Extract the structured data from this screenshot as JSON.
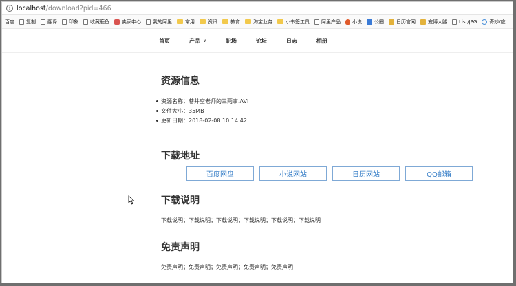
{
  "browser": {
    "url_host": "localhost",
    "url_path": "/download?pid=466",
    "bookmarks": [
      {
        "label": "百度",
        "icon": "none"
      },
      {
        "label": "复制",
        "icon": "page"
      },
      {
        "label": "翻译",
        "icon": "page"
      },
      {
        "label": "印象",
        "icon": "page"
      },
      {
        "label": "收藏鹿鱼",
        "icon": "page"
      },
      {
        "label": "卖家中心",
        "icon": "red"
      },
      {
        "label": "我的阿里",
        "icon": "page"
      },
      {
        "label": "常用",
        "icon": "folder"
      },
      {
        "label": "资讯",
        "icon": "folder"
      },
      {
        "label": "教育",
        "icon": "folder"
      },
      {
        "label": "淘宝业务",
        "icon": "folder"
      },
      {
        "label": "小书签工具",
        "icon": "folder"
      },
      {
        "label": "阿里产品",
        "icon": "page"
      },
      {
        "label": "小说",
        "icon": "flame"
      },
      {
        "label": "公园",
        "icon": "blue"
      },
      {
        "label": "日历官网",
        "icon": "yellow"
      },
      {
        "label": "宠博大腿",
        "icon": "yellow"
      },
      {
        "label": "List/JPG",
        "icon": "page"
      },
      {
        "label": "奇妙/应",
        "icon": "globe"
      }
    ]
  },
  "nav": {
    "items": [
      {
        "label": "首页",
        "dropdown": false
      },
      {
        "label": "产品",
        "dropdown": true
      },
      {
        "label": "职场",
        "dropdown": false
      },
      {
        "label": "论坛",
        "dropdown": false
      },
      {
        "label": "日志",
        "dropdown": false
      },
      {
        "label": "相册",
        "dropdown": false
      }
    ]
  },
  "resource": {
    "title": "资源信息",
    "items": [
      "资源名称：苍井空老师的三两事.AVI",
      "文件大小：35MB",
      "更新日期：2018-02-08 10:14:42"
    ]
  },
  "download": {
    "title": "下载地址",
    "buttons": [
      "百度网盘",
      "小说网站",
      "日历网站",
      "QQ邮箱"
    ]
  },
  "instructions": {
    "title": "下载说明",
    "text": "下载说明；下载说明；下载说明；下载说明；下载说明；下载说明"
  },
  "disclaimer": {
    "title": "免责声明",
    "text": "免责声明；免责声明；免责声明；免责声明；免责声明"
  }
}
